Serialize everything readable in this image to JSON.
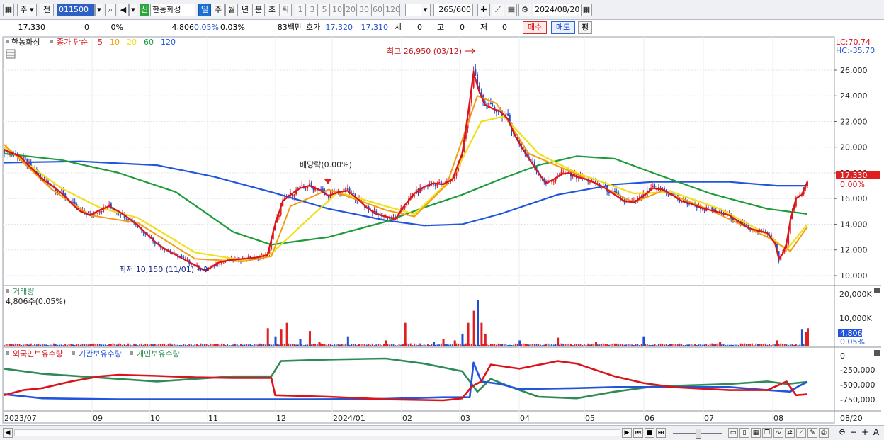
{
  "toolbar": {
    "period_label": "주",
    "prev_label": "전",
    "code": "011500",
    "badge": "신",
    "stock_name": "한농화성",
    "tabs": [
      "일",
      "주",
      "월",
      "년",
      "분",
      "초",
      "틱"
    ],
    "active_tab": "일",
    "intervals": [
      "1",
      "3",
      "5",
      "10",
      "20",
      "30",
      "60",
      "120"
    ],
    "count": "265",
    "count_total": "/600",
    "date": "2024/08/20"
  },
  "info": {
    "price": "17,330",
    "change": "0",
    "change_pct": "0%",
    "volume": "4,806",
    "volume_pct": "0.05%",
    "rate": "0.03%",
    "amount": "83백만",
    "quote_label": "호가",
    "ask": "17,320",
    "bid": "17,310",
    "open_label": "시",
    "open": "0",
    "high_label": "고",
    "high": "0",
    "low_label": "저",
    "low": "0",
    "buy": "매수",
    "sell": "매도",
    "avg": "평"
  },
  "legend": {
    "name": "한농화성",
    "type": "종가 단순",
    "ma": [
      {
        "period": "5",
        "color": "#d9141b"
      },
      {
        "period": "10",
        "color": "#f39c12"
      },
      {
        "period": "20",
        "color": "#f0e017"
      },
      {
        "period": "60",
        "color": "#1e9b3a"
      },
      {
        "period": "120",
        "color": "#2255dd"
      }
    ]
  },
  "annotations": {
    "high": "최고 26,950 (03/12)",
    "low": "최저 10,150 (11/01)",
    "dividend": "배당락(0.00%)",
    "lc": "LC:70.74",
    "hc": "HC:-35.70",
    "current_price": "17,330",
    "current_pct": "0.00%"
  },
  "volume_panel": {
    "title": "거래량",
    "value": "4,806주(0.05%)",
    "current": "4,806",
    "current_pct": "0.05%",
    "axis": [
      "20,000K",
      "10,000K"
    ]
  },
  "holdings_panel": {
    "items": [
      {
        "label": "외국인보유수량",
        "color": "#d9141b"
      },
      {
        "label": "기관보유수량",
        "color": "#2255dd"
      },
      {
        "label": "개인보유수량",
        "color": "#2e8b57"
      }
    ],
    "axis": [
      "0",
      "-250,000",
      "-500,000",
      "-750,000"
    ]
  },
  "x_axis": [
    "2023/07",
    "09",
    "10",
    "11",
    "12",
    "2024/01",
    "02",
    "03",
    "04",
    "05",
    "06",
    "07",
    "08",
    "08/20"
  ],
  "colors": {
    "up": "#e02020",
    "down": "#1f4fd1"
  },
  "chart_data": {
    "type": "candlestick",
    "y_range": [
      9500,
      27600
    ],
    "y_ticks": [
      10000,
      12000,
      14000,
      16000,
      18000,
      20000,
      22000,
      24000,
      26000
    ],
    "high": 26950,
    "low": 10150,
    "last": 17330,
    "close_path": [
      [
        0,
        19800
      ],
      [
        8,
        19300
      ],
      [
        14,
        18400
      ],
      [
        20,
        17500
      ],
      [
        27,
        16800
      ],
      [
        33,
        16000
      ],
      [
        36,
        15500
      ],
      [
        40,
        15000
      ],
      [
        45,
        14700
      ],
      [
        50,
        15100
      ],
      [
        55,
        15400
      ],
      [
        60,
        15000
      ],
      [
        65,
        14500
      ],
      [
        70,
        13900
      ],
      [
        75,
        13200
      ],
      [
        80,
        12500
      ],
      [
        85,
        12000
      ],
      [
        90,
        11600
      ],
      [
        95,
        11200
      ],
      [
        100,
        10800
      ],
      [
        105,
        10400
      ],
      [
        108,
        10600
      ],
      [
        112,
        11000
      ],
      [
        118,
        11200
      ],
      [
        125,
        11300
      ],
      [
        132,
        11400
      ],
      [
        138,
        11600
      ],
      [
        142,
        14000
      ],
      [
        146,
        15800
      ],
      [
        150,
        16300
      ],
      [
        155,
        16800
      ],
      [
        160,
        17000
      ],
      [
        165,
        16700
      ],
      [
        170,
        16200
      ],
      [
        175,
        16500
      ],
      [
        180,
        16600
      ],
      [
        185,
        16000
      ],
      [
        190,
        15300
      ],
      [
        195,
        14800
      ],
      [
        200,
        14600
      ],
      [
        205,
        14400
      ],
      [
        210,
        15500
      ],
      [
        215,
        16400
      ],
      [
        220,
        16900
      ],
      [
        225,
        17200
      ],
      [
        230,
        17100
      ],
      [
        235,
        17500
      ],
      [
        240,
        19500
      ],
      [
        243,
        22500
      ],
      [
        246,
        25800
      ],
      [
        249,
        24300
      ],
      [
        252,
        23300
      ],
      [
        256,
        23000
      ],
      [
        260,
        22800
      ],
      [
        264,
        22200
      ],
      [
        268,
        20800
      ],
      [
        272,
        19800
      ],
      [
        276,
        18900
      ],
      [
        280,
        18000
      ],
      [
        284,
        17200
      ],
      [
        288,
        17500
      ],
      [
        292,
        17900
      ],
      [
        296,
        18000
      ],
      [
        300,
        17700
      ],
      [
        305,
        17500
      ],
      [
        310,
        17200
      ],
      [
        315,
        16800
      ],
      [
        320,
        16300
      ],
      [
        325,
        15800
      ],
      [
        330,
        15700
      ],
      [
        335,
        16200
      ],
      [
        340,
        16800
      ],
      [
        345,
        16700
      ],
      [
        350,
        16300
      ],
      [
        355,
        15800
      ],
      [
        360,
        15600
      ],
      [
        365,
        15300
      ],
      [
        370,
        15100
      ],
      [
        375,
        14900
      ],
      [
        380,
        14700
      ],
      [
        385,
        14200
      ],
      [
        390,
        13700
      ],
      [
        395,
        13500
      ],
      [
        400,
        13300
      ],
      [
        404,
        12500
      ],
      [
        406,
        11300
      ],
      [
        408,
        11700
      ],
      [
        410,
        12500
      ],
      [
        412,
        14300
      ],
      [
        415,
        16000
      ],
      [
        418,
        16300
      ],
      [
        421,
        17330
      ]
    ],
    "ma_paths": {
      "ma120": [
        [
          0,
          18800
        ],
        [
          40,
          18900
        ],
        [
          80,
          18600
        ],
        [
          110,
          17700
        ],
        [
          140,
          16500
        ],
        [
          170,
          15200
        ],
        [
          200,
          14300
        ],
        [
          220,
          13900
        ],
        [
          240,
          14000
        ],
        [
          260,
          14800
        ],
        [
          290,
          16300
        ],
        [
          320,
          17100
        ],
        [
          340,
          17300
        ],
        [
          380,
          17300
        ],
        [
          405,
          17000
        ],
        [
          421,
          17000
        ]
      ],
      "ma60": [
        [
          0,
          19500
        ],
        [
          30,
          19000
        ],
        [
          60,
          18000
        ],
        [
          90,
          16500
        ],
        [
          120,
          13400
        ],
        [
          140,
          12400
        ],
        [
          170,
          13000
        ],
        [
          200,
          14200
        ],
        [
          220,
          15300
        ],
        [
          240,
          16300
        ],
        [
          260,
          17500
        ],
        [
          280,
          18600
        ],
        [
          300,
          19300
        ],
        [
          320,
          19100
        ],
        [
          340,
          18000
        ],
        [
          370,
          16400
        ],
        [
          400,
          15200
        ],
        [
          421,
          14800
        ]
      ],
      "ma20": [
        [
          0,
          20000
        ],
        [
          30,
          16800
        ],
        [
          50,
          15300
        ],
        [
          70,
          14500
        ],
        [
          100,
          11800
        ],
        [
          125,
          11200
        ],
        [
          140,
          11700
        ],
        [
          160,
          14500
        ],
        [
          175,
          16500
        ],
        [
          200,
          15400
        ],
        [
          215,
          14800
        ],
        [
          235,
          17600
        ],
        [
          250,
          22000
        ],
        [
          262,
          22400
        ],
        [
          280,
          19500
        ],
        [
          300,
          18000
        ],
        [
          330,
          16400
        ],
        [
          350,
          16500
        ],
        [
          375,
          15200
        ],
        [
          400,
          13200
        ],
        [
          410,
          12000
        ],
        [
          421,
          14000
        ]
      ],
      "ma10": [
        [
          0,
          20200
        ],
        [
          25,
          16700
        ],
        [
          45,
          14700
        ],
        [
          70,
          14100
        ],
        [
          100,
          11300
        ],
        [
          125,
          11100
        ],
        [
          140,
          11500
        ],
        [
          150,
          15400
        ],
        [
          170,
          16700
        ],
        [
          200,
          15100
        ],
        [
          215,
          14600
        ],
        [
          232,
          17100
        ],
        [
          248,
          24000
        ],
        [
          258,
          23400
        ],
        [
          275,
          19500
        ],
        [
          300,
          17900
        ],
        [
          330,
          15700
        ],
        [
          345,
          16600
        ],
        [
          370,
          15100
        ],
        [
          400,
          13000
        ],
        [
          412,
          11900
        ],
        [
          421,
          13800
        ]
      ]
    },
    "volume_spikes": [
      [
        138,
        6500
      ],
      [
        142,
        3500
      ],
      [
        145,
        6000
      ],
      [
        148,
        8500
      ],
      [
        155,
        2500
      ],
      [
        160,
        5500
      ],
      [
        165,
        1500
      ],
      [
        180,
        3500
      ],
      [
        200,
        2000
      ],
      [
        210,
        8500
      ],
      [
        225,
        1500
      ],
      [
        230,
        2500
      ],
      [
        236,
        2000
      ],
      [
        240,
        4500
      ],
      [
        243,
        8500
      ],
      [
        246,
        13000
      ],
      [
        248,
        17000
      ],
      [
        250,
        8500
      ],
      [
        252,
        4500
      ],
      [
        270,
        2000
      ],
      [
        290,
        3000
      ],
      [
        310,
        1500
      ],
      [
        335,
        3500
      ],
      [
        375,
        1500
      ],
      [
        405,
        2000
      ],
      [
        418,
        6000
      ],
      [
        420,
        5000
      ],
      [
        421,
        6500
      ]
    ],
    "foreign_path": [
      [
        0,
        0.72
      ],
      [
        10,
        0.62
      ],
      [
        20,
        0.58
      ],
      [
        35,
        0.45
      ],
      [
        50,
        0.35
      ],
      [
        60,
        0.32
      ],
      [
        80,
        0.34
      ],
      [
        100,
        0.37
      ],
      [
        120,
        0.38
      ],
      [
        140,
        0.38
      ],
      [
        142,
        0.72
      ],
      [
        170,
        0.75
      ],
      [
        200,
        0.8
      ],
      [
        230,
        0.82
      ],
      [
        240,
        0.78
      ],
      [
        245,
        0.55
      ],
      [
        250,
        0.45
      ],
      [
        255,
        0.12
      ],
      [
        270,
        0.2
      ],
      [
        290,
        0.05
      ],
      [
        300,
        0.1
      ],
      [
        320,
        0.35
      ],
      [
        335,
        0.48
      ],
      [
        350,
        0.56
      ],
      [
        380,
        0.62
      ],
      [
        400,
        0.62
      ],
      [
        410,
        0.45
      ],
      [
        415,
        0.72
      ],
      [
        421,
        0.7
      ]
    ],
    "inst_path": [
      [
        0,
        0.7
      ],
      [
        20,
        0.78
      ],
      [
        60,
        0.8
      ],
      [
        100,
        0.8
      ],
      [
        140,
        0.8
      ],
      [
        160,
        0.8
      ],
      [
        200,
        0.79
      ],
      [
        230,
        0.76
      ],
      [
        244,
        0.76
      ],
      [
        246,
        0.08
      ],
      [
        250,
        0.45
      ],
      [
        260,
        0.5
      ],
      [
        270,
        0.6
      ],
      [
        300,
        0.58
      ],
      [
        320,
        0.56
      ],
      [
        340,
        0.56
      ],
      [
        380,
        0.56
      ],
      [
        400,
        0.62
      ],
      [
        412,
        0.65
      ],
      [
        416,
        0.55
      ],
      [
        421,
        0.46
      ]
    ],
    "indiv_path": [
      [
        0,
        0.2
      ],
      [
        20,
        0.3
      ],
      [
        40,
        0.35
      ],
      [
        60,
        0.4
      ],
      [
        80,
        0.45
      ],
      [
        100,
        0.4
      ],
      [
        120,
        0.35
      ],
      [
        140,
        0.35
      ],
      [
        145,
        0.05
      ],
      [
        170,
        0.02
      ],
      [
        200,
        0.0
      ],
      [
        220,
        0.1
      ],
      [
        240,
        0.25
      ],
      [
        248,
        0.65
      ],
      [
        255,
        0.4
      ],
      [
        265,
        0.55
      ],
      [
        280,
        0.75
      ],
      [
        300,
        0.78
      ],
      [
        320,
        0.65
      ],
      [
        340,
        0.55
      ],
      [
        380,
        0.5
      ],
      [
        400,
        0.45
      ],
      [
        410,
        0.5
      ],
      [
        421,
        0.46
      ]
    ]
  }
}
